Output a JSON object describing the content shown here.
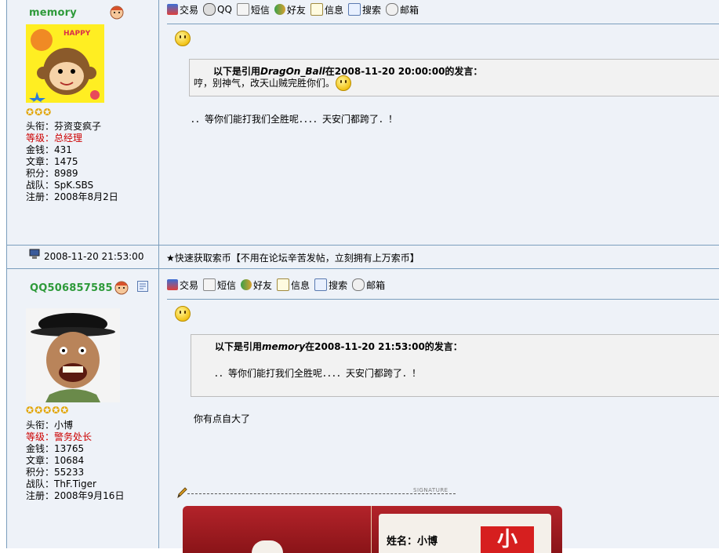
{
  "post1": {
    "username": "memory",
    "stars": 3,
    "info": [
      {
        "label": "头衔：芬资变疯子",
        "rank": false
      },
      {
        "label": "等级：总经理",
        "rank": true
      },
      {
        "label": "金钱：431",
        "rank": false
      },
      {
        "label": "文章：1475",
        "rank": false
      },
      {
        "label": "积分：8989",
        "rank": false
      },
      {
        "label": "战队：SpK.SBS",
        "rank": false
      },
      {
        "label": "注册：2008年8月2日",
        "rank": false
      }
    ],
    "toolbar": [
      "交易",
      "QQ",
      "短信",
      "好友",
      "信息",
      "搜索",
      "邮箱"
    ],
    "quote_prefix": "以下是引用",
    "quote_author": "DragOn_Ball",
    "quote_suffix": "在2008-11-20 20:00:00的发言：",
    "quote_body": "哼，别神气，改天山贼完胜你们。",
    "body": "．．等你们能打我们全胜呢．．．．天安门都跨了．！"
  },
  "post_meta": {
    "timestamp": "2008-11-20 21:53:00",
    "ad_text": "★快速获取索币【不用在论坛辛苦发帖，立刻拥有上万索币】"
  },
  "post2": {
    "username": "QQ506857585",
    "stars": 5,
    "info": [
      {
        "label": "头衔：小博",
        "rank": false
      },
      {
        "label": "等级：警务处长",
        "rank": true
      },
      {
        "label": "金钱：13765",
        "rank": false
      },
      {
        "label": "文章：10684",
        "rank": false
      },
      {
        "label": "积分：55233",
        "rank": false
      },
      {
        "label": "战队：ThF.Tiger",
        "rank": false
      },
      {
        "label": "注册：2008年9月16日",
        "rank": false
      }
    ],
    "toolbar": [
      "交易",
      "短信",
      "好友",
      "信息",
      "搜索",
      "邮箱"
    ],
    "quote_prefix": "以下是引用",
    "quote_author": "memory",
    "quote_suffix": "在2008-11-20 21:53:00的发言：",
    "quote_body": "．．等你们能打我们全胜呢．．．．天安门都跨了．！",
    "body": "你有点自大了",
    "signature_label": "SIGNATURE",
    "card_name_label": "姓名：小博",
    "card_stamp": "小"
  },
  "colors": {
    "border": "#7b9ebd",
    "username": "#2e9a3a",
    "rank": "#cc0000",
    "panel_bg": "#eef2f8"
  }
}
